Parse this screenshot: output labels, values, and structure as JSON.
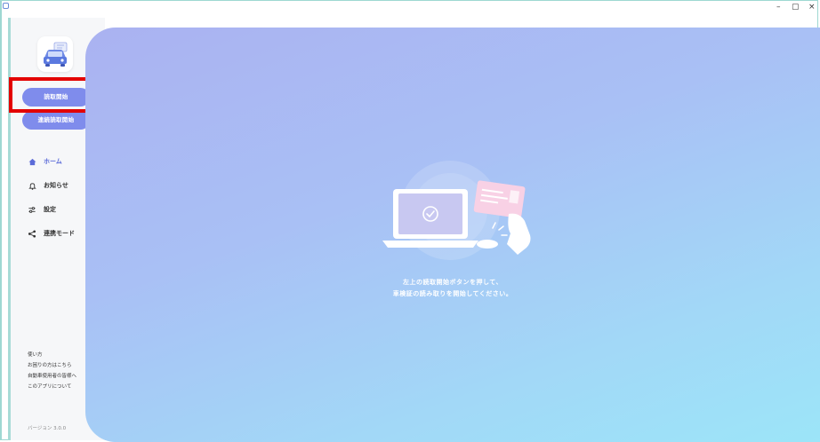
{
  "window": {
    "minimize": "–",
    "maximize": "▢",
    "close": "×"
  },
  "sidebar": {
    "buttons": {
      "start_reading": "読取開始",
      "continuous_reading": "連続読取開始"
    },
    "nav": [
      {
        "label": "ホーム",
        "icon": "home-icon",
        "active": true
      },
      {
        "label": "お知らせ",
        "icon": "bell-icon",
        "active": false
      },
      {
        "label": "設定",
        "icon": "settings-sliders-icon",
        "active": false
      },
      {
        "label": "連携モード",
        "icon": "share-icon",
        "active": false
      }
    ],
    "footer_links": [
      "使い方",
      "お困りの方はこちら",
      "自動車使用者の皆様へ",
      "このアプリについて"
    ],
    "version": "バージョン 3.0.0"
  },
  "main": {
    "message_line1": "左上の読取開始ボタンを押して、",
    "message_line2": "車検証の読み取りを開始してください。"
  },
  "colors": {
    "accent": "#7f8cec",
    "highlight": "#e30000",
    "pointer": "#b83e12",
    "frame": "#9ed8d2"
  }
}
